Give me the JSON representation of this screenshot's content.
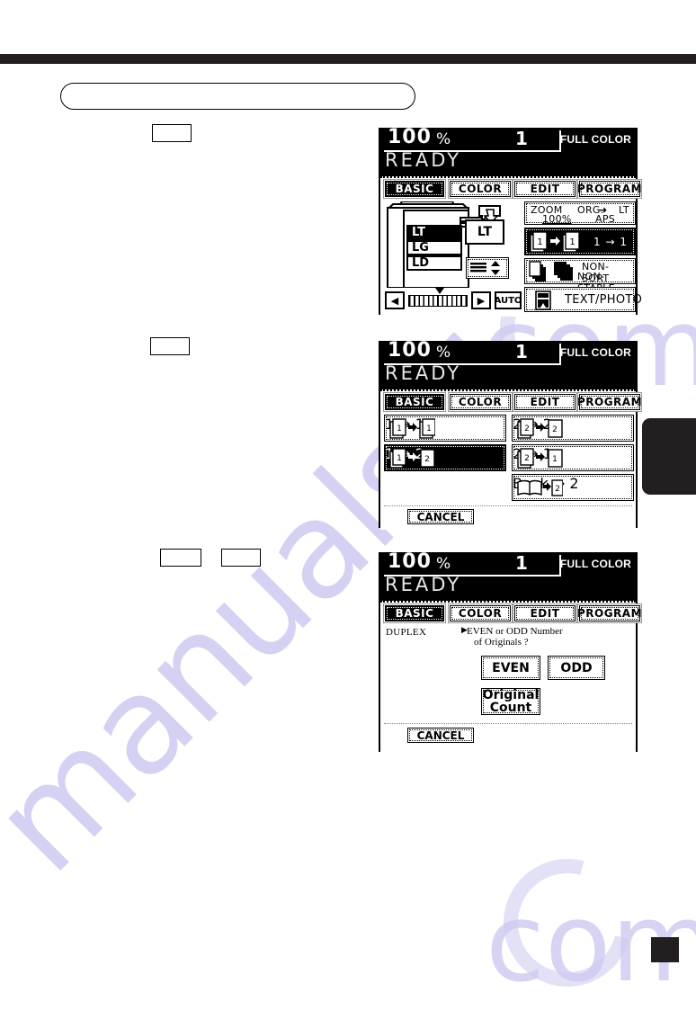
{
  "page": {
    "marker_label": "",
    "watermark_text": "manualshi",
    "watermark_suffix": "com"
  },
  "callouts": {
    "title_pill": "",
    "step_box_1": "",
    "step_box_2": "",
    "step_box_3a": "",
    "step_box_3b": ""
  },
  "colors": {
    "ink": "#000000",
    "rule": "#231f20",
    "watermark": "#cdcaf0",
    "lcd_background": "#ffffff",
    "lcd_status_background": "#000000"
  },
  "panels": [
    {
      "id": "basic-paper-panel",
      "status": {
        "zoom_percent": "100",
        "percent_symbol": "%",
        "copy_count": "1",
        "color_mode": "FULL COLOR",
        "message": "READY"
      },
      "tabs": [
        {
          "label": "BASIC",
          "selected": true
        },
        {
          "label": "COLOR",
          "selected": false
        },
        {
          "label": "EDIT",
          "selected": false
        },
        {
          "label": "PROGRAM",
          "selected": false
        }
      ],
      "paper_cassettes": [
        {
          "label": "LT",
          "selected": true
        },
        {
          "label": "LG",
          "selected": false
        },
        {
          "label": "LD",
          "selected": false
        }
      ],
      "bypass_size": "LT",
      "density": {
        "left_arrow": "◀",
        "right_arrow": "▶",
        "auto_label": "AUTO"
      },
      "zoom_button": {
        "zoom_label": "ZOOM",
        "zoom_value": "100%",
        "org_label": "ORG.",
        "org_arrow": "➜",
        "org_value": "LT",
        "aps_label": "APS"
      },
      "duplex_button": {
        "label": "1 → 1",
        "selected": true
      },
      "finish_button": {
        "line1": "NON-SORT",
        "line2": "NON-STAPLE"
      },
      "original_mode_button": {
        "label": "TEXT/PHOTO"
      }
    },
    {
      "id": "duplex-mode-panel",
      "status": {
        "zoom_percent": "100",
        "percent_symbol": "%",
        "copy_count": "1",
        "color_mode": "FULL COLOR",
        "message": "READY"
      },
      "tabs": [
        {
          "label": "BASIC",
          "selected": true
        },
        {
          "label": "COLOR",
          "selected": false
        },
        {
          "label": "EDIT",
          "selected": false
        },
        {
          "label": "PROGRAM",
          "selected": false
        }
      ],
      "options": [
        {
          "label": "1 → 1",
          "selected": false,
          "column": "left"
        },
        {
          "label": "1 → 2",
          "selected": true,
          "column": "left"
        },
        {
          "label": "2 → 2",
          "selected": false,
          "column": "right"
        },
        {
          "label": "2 → 1",
          "selected": false,
          "column": "right"
        },
        {
          "label": "Book → 2",
          "selected": false,
          "column": "right"
        }
      ],
      "cancel_label": "CANCEL"
    },
    {
      "id": "duplex-even-odd-panel",
      "status": {
        "zoom_percent": "100",
        "percent_symbol": "%",
        "copy_count": "1",
        "color_mode": "FULL COLOR",
        "message": "READY"
      },
      "tabs": [
        {
          "label": "BASIC",
          "selected": true
        },
        {
          "label": "COLOR",
          "selected": false
        },
        {
          "label": "EDIT",
          "selected": false
        },
        {
          "label": "PROGRAM",
          "selected": false
        }
      ],
      "feature_label": "DUPLEX",
      "prompt_arrow": "▶",
      "prompt_line1": "EVEN or ODD Number",
      "prompt_line2": "of Originals ?",
      "buttons": {
        "even": "EVEN",
        "odd": "ODD",
        "original_count_line1": "Original",
        "original_count_line2": "Count"
      },
      "cancel_label": "CANCEL"
    }
  ]
}
